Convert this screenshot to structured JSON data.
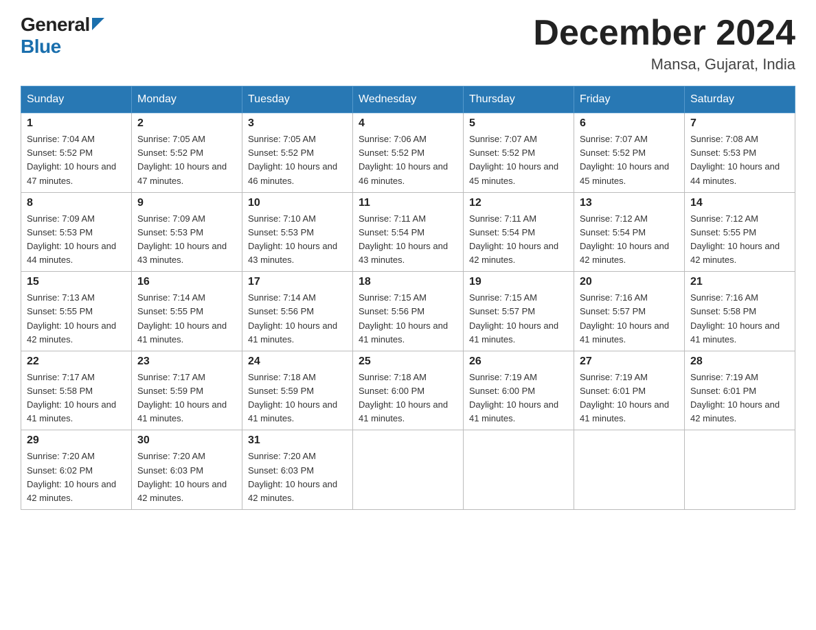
{
  "header": {
    "logo_general": "General",
    "logo_blue": "Blue",
    "month_title": "December 2024",
    "location": "Mansa, Gujarat, India"
  },
  "days_of_week": [
    "Sunday",
    "Monday",
    "Tuesday",
    "Wednesday",
    "Thursday",
    "Friday",
    "Saturday"
  ],
  "weeks": [
    [
      {
        "day": "1",
        "sunrise": "7:04 AM",
        "sunset": "5:52 PM",
        "daylight": "10 hours and 47 minutes."
      },
      {
        "day": "2",
        "sunrise": "7:05 AM",
        "sunset": "5:52 PM",
        "daylight": "10 hours and 47 minutes."
      },
      {
        "day": "3",
        "sunrise": "7:05 AM",
        "sunset": "5:52 PM",
        "daylight": "10 hours and 46 minutes."
      },
      {
        "day": "4",
        "sunrise": "7:06 AM",
        "sunset": "5:52 PM",
        "daylight": "10 hours and 46 minutes."
      },
      {
        "day": "5",
        "sunrise": "7:07 AM",
        "sunset": "5:52 PM",
        "daylight": "10 hours and 45 minutes."
      },
      {
        "day": "6",
        "sunrise": "7:07 AM",
        "sunset": "5:52 PM",
        "daylight": "10 hours and 45 minutes."
      },
      {
        "day": "7",
        "sunrise": "7:08 AM",
        "sunset": "5:53 PM",
        "daylight": "10 hours and 44 minutes."
      }
    ],
    [
      {
        "day": "8",
        "sunrise": "7:09 AM",
        "sunset": "5:53 PM",
        "daylight": "10 hours and 44 minutes."
      },
      {
        "day": "9",
        "sunrise": "7:09 AM",
        "sunset": "5:53 PM",
        "daylight": "10 hours and 43 minutes."
      },
      {
        "day": "10",
        "sunrise": "7:10 AM",
        "sunset": "5:53 PM",
        "daylight": "10 hours and 43 minutes."
      },
      {
        "day": "11",
        "sunrise": "7:11 AM",
        "sunset": "5:54 PM",
        "daylight": "10 hours and 43 minutes."
      },
      {
        "day": "12",
        "sunrise": "7:11 AM",
        "sunset": "5:54 PM",
        "daylight": "10 hours and 42 minutes."
      },
      {
        "day": "13",
        "sunrise": "7:12 AM",
        "sunset": "5:54 PM",
        "daylight": "10 hours and 42 minutes."
      },
      {
        "day": "14",
        "sunrise": "7:12 AM",
        "sunset": "5:55 PM",
        "daylight": "10 hours and 42 minutes."
      }
    ],
    [
      {
        "day": "15",
        "sunrise": "7:13 AM",
        "sunset": "5:55 PM",
        "daylight": "10 hours and 42 minutes."
      },
      {
        "day": "16",
        "sunrise": "7:14 AM",
        "sunset": "5:55 PM",
        "daylight": "10 hours and 41 minutes."
      },
      {
        "day": "17",
        "sunrise": "7:14 AM",
        "sunset": "5:56 PM",
        "daylight": "10 hours and 41 minutes."
      },
      {
        "day": "18",
        "sunrise": "7:15 AM",
        "sunset": "5:56 PM",
        "daylight": "10 hours and 41 minutes."
      },
      {
        "day": "19",
        "sunrise": "7:15 AM",
        "sunset": "5:57 PM",
        "daylight": "10 hours and 41 minutes."
      },
      {
        "day": "20",
        "sunrise": "7:16 AM",
        "sunset": "5:57 PM",
        "daylight": "10 hours and 41 minutes."
      },
      {
        "day": "21",
        "sunrise": "7:16 AM",
        "sunset": "5:58 PM",
        "daylight": "10 hours and 41 minutes."
      }
    ],
    [
      {
        "day": "22",
        "sunrise": "7:17 AM",
        "sunset": "5:58 PM",
        "daylight": "10 hours and 41 minutes."
      },
      {
        "day": "23",
        "sunrise": "7:17 AM",
        "sunset": "5:59 PM",
        "daylight": "10 hours and 41 minutes."
      },
      {
        "day": "24",
        "sunrise": "7:18 AM",
        "sunset": "5:59 PM",
        "daylight": "10 hours and 41 minutes."
      },
      {
        "day": "25",
        "sunrise": "7:18 AM",
        "sunset": "6:00 PM",
        "daylight": "10 hours and 41 minutes."
      },
      {
        "day": "26",
        "sunrise": "7:19 AM",
        "sunset": "6:00 PM",
        "daylight": "10 hours and 41 minutes."
      },
      {
        "day": "27",
        "sunrise": "7:19 AM",
        "sunset": "6:01 PM",
        "daylight": "10 hours and 41 minutes."
      },
      {
        "day": "28",
        "sunrise": "7:19 AM",
        "sunset": "6:01 PM",
        "daylight": "10 hours and 42 minutes."
      }
    ],
    [
      {
        "day": "29",
        "sunrise": "7:20 AM",
        "sunset": "6:02 PM",
        "daylight": "10 hours and 42 minutes."
      },
      {
        "day": "30",
        "sunrise": "7:20 AM",
        "sunset": "6:03 PM",
        "daylight": "10 hours and 42 minutes."
      },
      {
        "day": "31",
        "sunrise": "7:20 AM",
        "sunset": "6:03 PM",
        "daylight": "10 hours and 42 minutes."
      },
      null,
      null,
      null,
      null
    ]
  ]
}
